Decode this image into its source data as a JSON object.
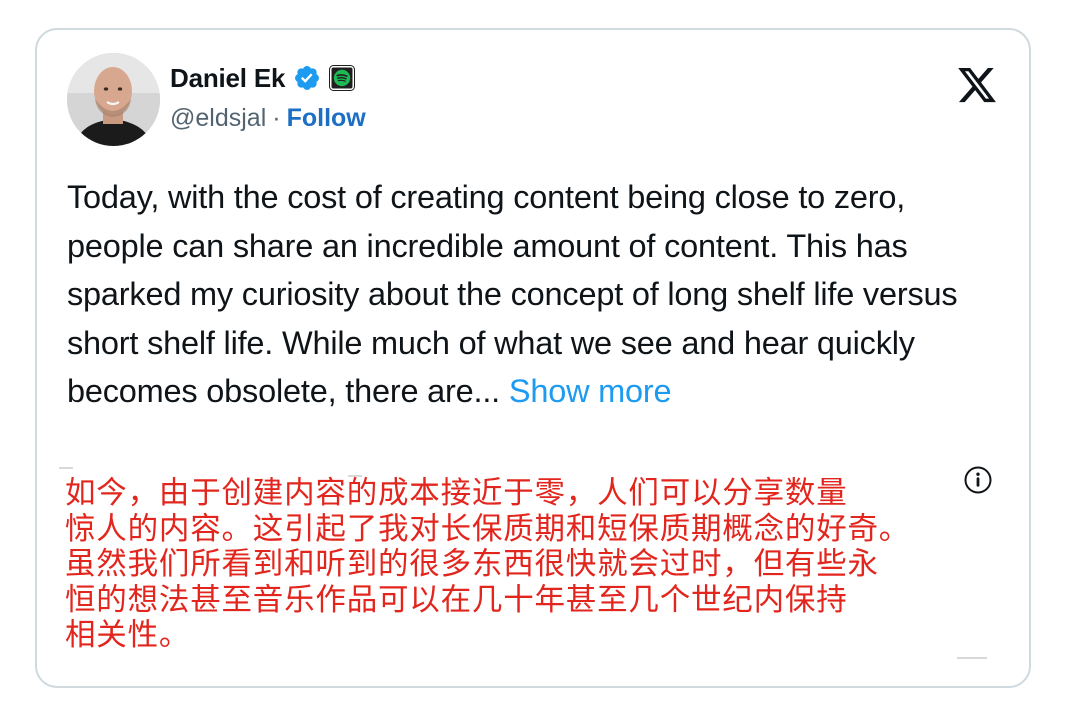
{
  "tweet": {
    "author": {
      "display_name": "Daniel Ek",
      "handle": "@eldsjal",
      "separator": "·",
      "follow_label": "Follow",
      "verified_icon": "verified-badge-icon",
      "affiliate_icon": "spotify-icon"
    },
    "platform_icon": "x-logo-icon",
    "body": "Today, with the cost of creating content being close to zero, people can share an incredible amount of content. This has sparked my curiosity about the concept of long shelf life versus short shelf life. While much of what we see and hear quickly becomes obsolete, there are...",
    "show_more_label": "Show more",
    "translation": "如今，由于创建内容的成本接近于零，人们可以分享数量\n惊人的内容。这引起了我对长保质期和短保质期概念的好奇。\n虽然我们所看到和听到的很多东西很快就会过时，但有些永\n恒的想法甚至音乐作品可以在几十年甚至几个世纪内保持\n相关性。",
    "info_icon": "info-icon"
  },
  "colors": {
    "text": "#0f1419",
    "secondary": "#536471",
    "link": "#1d9bf0",
    "follow": "#1d6fc4",
    "translation": "#e2261e",
    "border": "#cfd9de",
    "verified": "#1d9bf0",
    "spotify": "#1db954"
  }
}
